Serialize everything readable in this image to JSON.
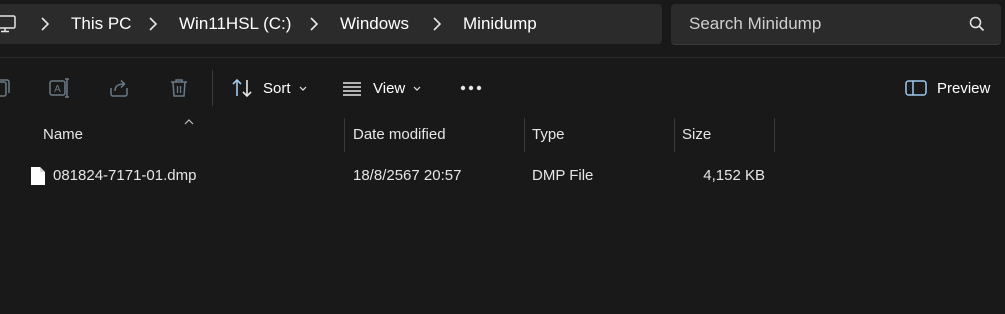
{
  "breadcrumb": {
    "items": [
      {
        "label": "This PC"
      },
      {
        "label": "Win11HSL (C:)"
      },
      {
        "label": "Windows"
      },
      {
        "label": "Minidump"
      }
    ]
  },
  "search": {
    "placeholder": "Search Minidump"
  },
  "toolbar": {
    "sort_label": "Sort",
    "view_label": "View",
    "preview_label": "Preview",
    "icons": [
      "copy-icon",
      "rename-icon",
      "share-icon",
      "delete-icon",
      "sort-icon",
      "view-icon",
      "more-icon",
      "preview-icon"
    ]
  },
  "columns": {
    "name": "Name",
    "date_modified": "Date modified",
    "type": "Type",
    "size": "Size"
  },
  "files": [
    {
      "name": "081824-7171-01.dmp",
      "date_modified": "18/8/2567 20:57",
      "type": "DMP File",
      "size": "4,152 KB"
    }
  ],
  "colors": {
    "background": "#191919",
    "bar": "#2b2b2b",
    "text": "#ffffff",
    "muted_icon": "#6a7a86",
    "accent_icon": "#9ec9ec"
  }
}
